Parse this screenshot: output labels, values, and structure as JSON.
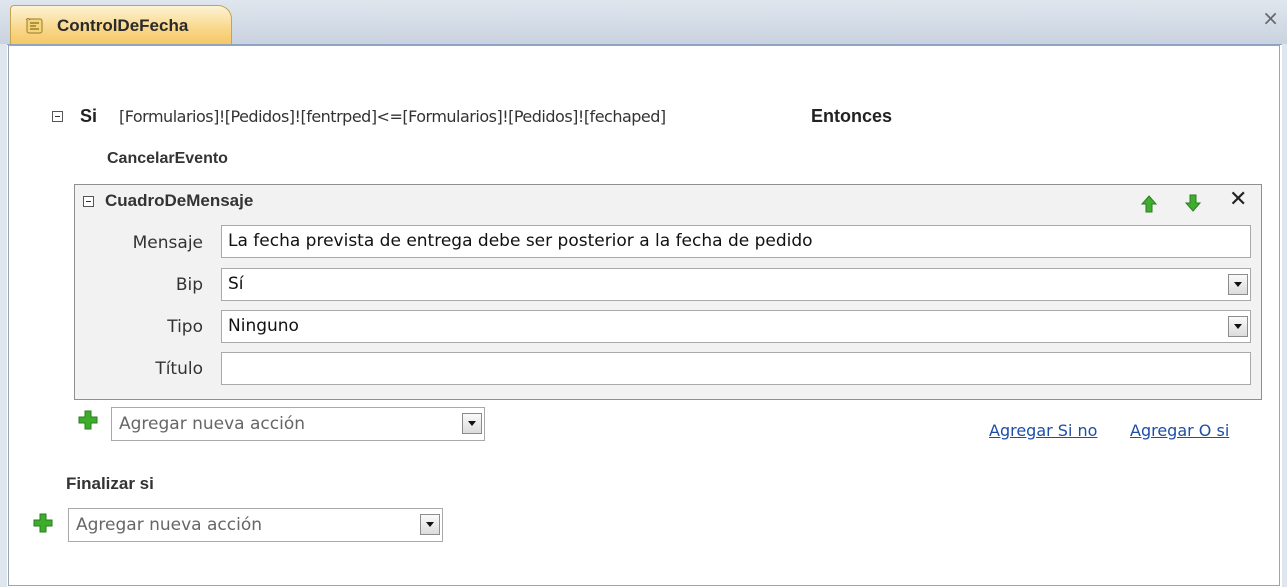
{
  "window": {
    "tab_title": "ControlDeFecha",
    "close_glyph": "×"
  },
  "macro": {
    "if_keyword": "Si",
    "condition": "[Formularios]![Pedidos]![fentrped]<=[Formularios]![Pedidos]![fechaped]",
    "then_keyword": "Entonces",
    "action_cancel": "CancelarEvento",
    "msgbox": {
      "title": "CuadroDeMensaje",
      "labels": {
        "mensaje": "Mensaje",
        "bip": "Bip",
        "tipo": "Tipo",
        "titulo": "Título"
      },
      "values": {
        "mensaje": "La fecha prevista de entrega debe ser posterior a la fecha de pedido",
        "bip": "Sí",
        "tipo": "Ninguno",
        "titulo": ""
      },
      "delete_glyph": "✕"
    },
    "add_action_inner": "Agregar nueva acción",
    "add_else_link": "Agregar Si no",
    "add_elseif_link": "Agregar O si",
    "end_if": "Finalizar si",
    "add_action_outer": "Agregar nueva acción"
  },
  "colors": {
    "tab": "#f6c866",
    "link": "#1c4ea8",
    "plus_green": "#3cae2a",
    "arrow_green": "#3fae2e"
  },
  "icons": [
    "macro-icon",
    "close-icon",
    "collapse-icon",
    "move-up-icon",
    "move-down-icon",
    "delete-icon",
    "dropdown-arrow-icon",
    "add-icon"
  ]
}
